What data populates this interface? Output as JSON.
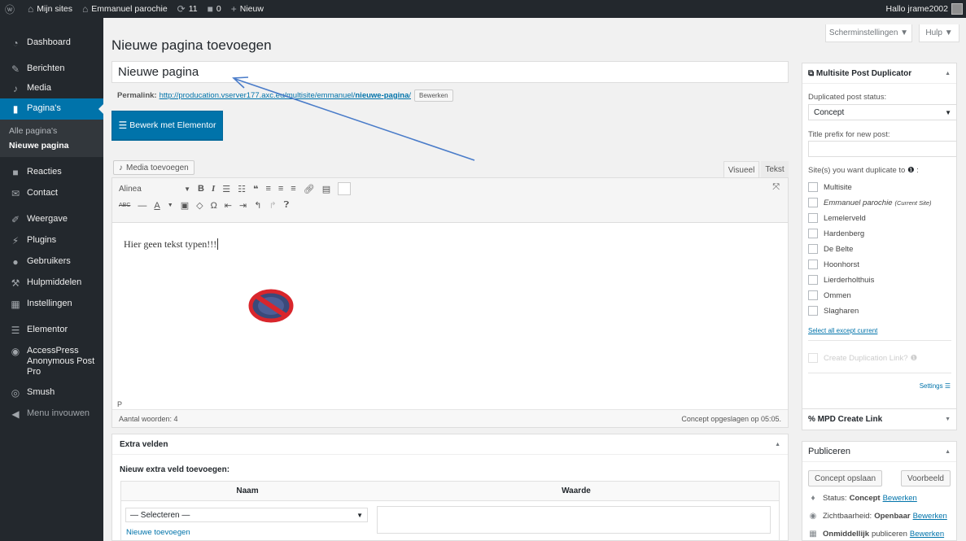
{
  "adminbar": {
    "my_sites": "Mijn sites",
    "site_name": "Emmanuel parochie",
    "updates_count": "11",
    "comments_count": "0",
    "new_label": "Nieuw",
    "greeting": "Hallo jrame2002"
  },
  "menu": {
    "dashboard": "Dashboard",
    "posts": "Berichten",
    "media": "Media",
    "pages": "Pagina's",
    "all_pages": "Alle pagina's",
    "new_page": "Nieuwe pagina",
    "comments": "Reacties",
    "contact": "Contact",
    "appearance": "Weergave",
    "plugins": "Plugins",
    "users": "Gebruikers",
    "tools": "Hulpmiddelen",
    "settings": "Instellingen",
    "elementor": "Elementor",
    "accesspress": "AccessPress Anonymous Post Pro",
    "smush": "Smush",
    "collapse": "Menu invouwen"
  },
  "header": {
    "screen_options": "Scherminstellingen ▼",
    "help": "Hulp ▼",
    "page_title": "Nieuwe pagina toevoegen"
  },
  "editor": {
    "title_value": "Nieuwe pagina",
    "permalink_label": "Permalink:",
    "permalink_url": "http://producation.vserver177.axc.eu/multisite/emmanuel/",
    "permalink_slug": "nieuwe-pagina",
    "permalink_edit": "Bewerken",
    "elementor_button": "Bewerk met Elementor",
    "media_button": "Media toevoegen",
    "tab_visual": "Visueel",
    "tab_text": "Tekst",
    "format_select": "Alinea",
    "content_text": "Hier geen tekst typen!!!",
    "path": "P",
    "word_count": "Aantal woorden: 4",
    "draft_saved": "Concept opgeslagen op 05:05."
  },
  "extra_fields": {
    "title": "Extra velden",
    "add_new_label": "Nieuw extra veld toevoegen:",
    "col_name": "Naam",
    "col_value": "Waarde",
    "select_placeholder": "— Selecteren —",
    "add_link": "Nieuwe toevoegen"
  },
  "mpd": {
    "title": "Multisite Post Duplicator",
    "status_label": "Duplicated post status:",
    "status_value": "Concept",
    "prefix_label": "Title prefix for new post:",
    "prefix_value": "",
    "sites_label": "Site(s) you want duplicate to",
    "sites": [
      {
        "name": "Multisite",
        "note": ""
      },
      {
        "name": "Emmanuel parochie",
        "note": "(Current Site)"
      },
      {
        "name": "Lemelerveld",
        "note": ""
      },
      {
        "name": "Hardenberg",
        "note": ""
      },
      {
        "name": "De Belte",
        "note": ""
      },
      {
        "name": "Hoonhorst",
        "note": ""
      },
      {
        "name": "Lierderholthuis",
        "note": ""
      },
      {
        "name": "Ommen",
        "note": ""
      },
      {
        "name": "Slagharen",
        "note": ""
      }
    ],
    "select_all": "Select all except current",
    "create_link": "Create Duplication Link?",
    "settings": "Settings"
  },
  "mpd_create": {
    "title": "MPD Create Link"
  },
  "publish": {
    "title": "Publiceren",
    "save_draft": "Concept opslaan",
    "preview": "Voorbeeld",
    "status_label": "Status:",
    "status_value": "Concept",
    "visibility_label": "Zichtbaarheid:",
    "visibility_value": "Openbaar",
    "schedule_value": "Onmiddellijk",
    "schedule_label": "publiceren",
    "edit": "Bewerken"
  },
  "colors": {
    "adminbar_bg": "#23282d",
    "accent": "#0073aa",
    "annotation_arrow": "#4a7cc9",
    "forbidden_red": "#d9262c",
    "forbidden_navy": "#3a4a7a"
  }
}
